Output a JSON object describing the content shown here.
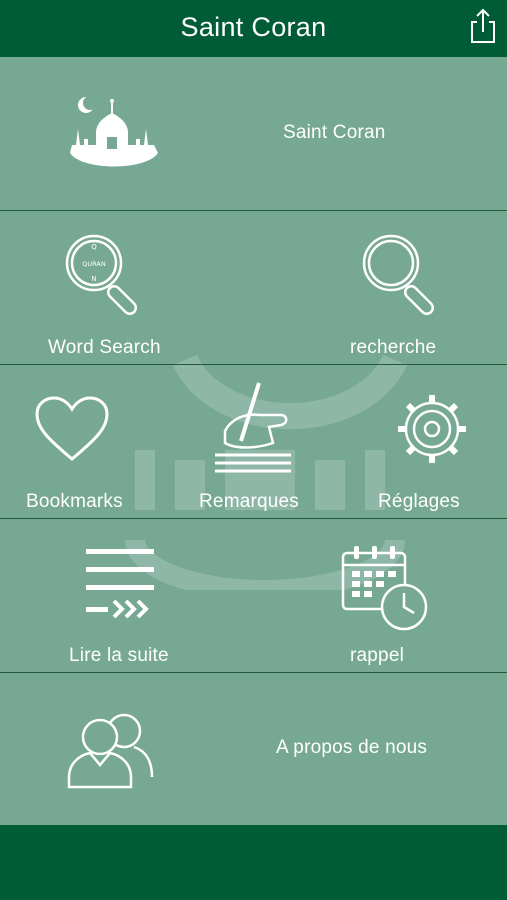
{
  "header": {
    "title": "Saint Coran"
  },
  "menu": {
    "saint_coran": "Saint Coran",
    "word_search": "Word Search",
    "recherche": "recherche",
    "bookmarks": "Bookmarks",
    "remarques": "Remarques",
    "reglages": "Réglages",
    "lire_la_suite": "Lire la suite",
    "rappel": "rappel",
    "a_propos": "A propos de nous"
  },
  "magnifier_text": {
    "top": "Q",
    "middle": "QURAN",
    "bottom": "N"
  },
  "icons": {
    "share": "share-icon",
    "mosque": "mosque-icon",
    "quran_search": "quran-search-icon",
    "search": "search-icon",
    "heart": "heart-icon",
    "writing": "writing-hand-icon",
    "gear": "gear-icon",
    "list": "list-continue-icon",
    "calendar_clock": "calendar-clock-icon",
    "users": "users-icon"
  },
  "colors": {
    "header": "#005c37",
    "background": "#76a894",
    "divider": "#1f5a40",
    "icon": "#ffffff"
  }
}
